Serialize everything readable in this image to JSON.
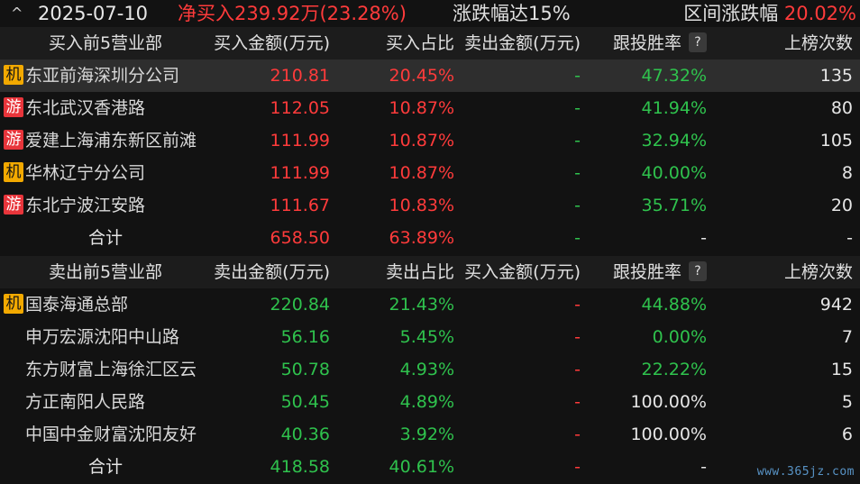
{
  "topbar": {
    "chevron": "^",
    "date": "2025-07-10",
    "net_buy": "净买入239.92万(23.28%)",
    "limit": "涨跌幅达15%",
    "range_label": "区间涨跌幅",
    "range_value": "20.02%"
  },
  "buy_section": {
    "headers": {
      "name": "买入前5营业部",
      "amount": "买入金额(万元)",
      "ratio": "买入占比",
      "other_amount": "卖出金额(万元)",
      "win_rate": "跟投胜率",
      "help": "?",
      "count": "上榜次数"
    },
    "rows": [
      {
        "badge": "机",
        "badge_type": "ji",
        "name": "东亚前海深圳分公司",
        "amount": "210.81",
        "ratio": "20.45%",
        "other": "-",
        "win": "47.32%",
        "count": "135"
      },
      {
        "badge": "游",
        "badge_type": "you",
        "name": "东北武汉香港路",
        "amount": "112.05",
        "ratio": "10.87%",
        "other": "-",
        "win": "41.94%",
        "count": "80"
      },
      {
        "badge": "游",
        "badge_type": "you",
        "name": "爱建上海浦东新区前滩",
        "amount": "111.99",
        "ratio": "10.87%",
        "other": "-",
        "win": "32.94%",
        "count": "105"
      },
      {
        "badge": "机",
        "badge_type": "ji",
        "name": "华林辽宁分公司",
        "amount": "111.99",
        "ratio": "10.87%",
        "other": "-",
        "win": "40.00%",
        "count": "8"
      },
      {
        "badge": "游",
        "badge_type": "you",
        "name": "东北宁波江安路",
        "amount": "111.67",
        "ratio": "10.83%",
        "other": "-",
        "win": "35.71%",
        "count": "20"
      }
    ],
    "total": {
      "label": "合计",
      "amount": "658.50",
      "ratio": "63.89%",
      "other": "-",
      "win": "-",
      "count": "-"
    }
  },
  "sell_section": {
    "headers": {
      "name": "卖出前5营业部",
      "amount": "卖出金额(万元)",
      "ratio": "卖出占比",
      "other_amount": "买入金额(万元)",
      "win_rate": "跟投胜率",
      "help": "?",
      "count": "上榜次数"
    },
    "rows": [
      {
        "badge": "机",
        "badge_type": "ji",
        "name": "国泰海通总部",
        "amount": "220.84",
        "ratio": "21.43%",
        "other": "-",
        "win": "44.88%",
        "count": "942"
      },
      {
        "badge": "",
        "badge_type": "",
        "name": "申万宏源沈阳中山路",
        "amount": "56.16",
        "ratio": "5.45%",
        "other": "-",
        "win": "0.00%",
        "count": "7"
      },
      {
        "badge": "",
        "badge_type": "",
        "name": "东方财富上海徐汇区云",
        "amount": "50.78",
        "ratio": "4.93%",
        "other": "-",
        "win": "22.22%",
        "count": "15"
      },
      {
        "badge": "",
        "badge_type": "",
        "name": "方正南阳人民路",
        "amount": "50.45",
        "ratio": "4.89%",
        "other": "-",
        "win": "100.00%",
        "count": "5"
      },
      {
        "badge": "",
        "badge_type": "",
        "name": "中国中金财富沈阳友好",
        "amount": "40.36",
        "ratio": "3.92%",
        "other": "-",
        "win": "100.00%",
        "count": "6"
      }
    ],
    "total": {
      "label": "合计",
      "amount": "418.58",
      "ratio": "40.61%",
      "other": "-",
      "win": "-",
      "count": ""
    }
  },
  "watermark": "www.365jz.com",
  "colors": {
    "up": "#ff3b3b",
    "down": "#2fc24d",
    "badge_ji": "#f2a900",
    "badge_you": "#e8353b"
  }
}
